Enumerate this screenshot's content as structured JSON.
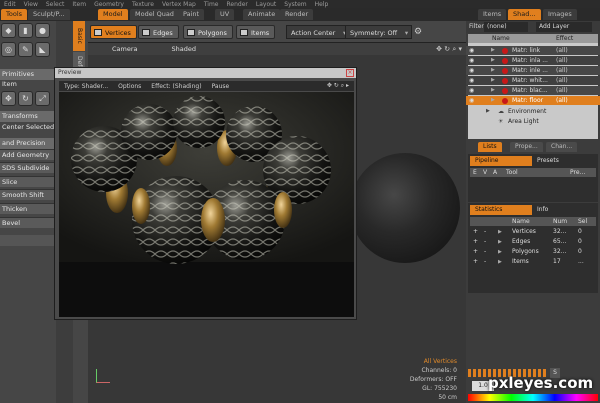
{
  "menubar": [
    "Edit",
    "View",
    "Select",
    "Item",
    "Geometry",
    "Texture",
    "Vertex Map",
    "Time",
    "Render",
    "Layout",
    "System",
    "Help"
  ],
  "layout_tabs": [
    "Tools",
    "Sculpt/P...",
    "Model",
    "Model Quad",
    "Paint",
    "UV",
    "Animate",
    "Render"
  ],
  "right_tabs": [
    "Items",
    "Shad...",
    "Images"
  ],
  "toolbar": {
    "vertices": "Vertices",
    "edges": "Edges",
    "polygons": "Polygons",
    "items": "Items",
    "action_center": "Action Center",
    "symmetry": "Symmetry: Off"
  },
  "left_panel": {
    "items": [
      "Primitives",
      "Item",
      "Transforms",
      "Center Selected",
      "and Precision",
      "Add Geometry",
      "SDS Subdivide",
      "Slice",
      "Smooth Shift",
      "Thicken",
      "Bevel"
    ],
    "vtab1": "Basic",
    "vtab2": "Deform"
  },
  "viewport": {
    "camera": "Camera",
    "shaded": "Shaded",
    "overlay_label": "All Vertices",
    "channels": "Channels: 0",
    "deformers": "Deformers: OFF",
    "gl": "GL: 755230",
    "scale": "50 cm",
    "icons": "✥ ↻ ⌕ ▾"
  },
  "preview": {
    "title": "Preview",
    "close": "×",
    "bar": [
      "Type: Shader...",
      "Options",
      "Effect: (Shading)",
      "Pause"
    ],
    "icons": "✥ ↻ ⌕ ▸"
  },
  "shader": {
    "filter_label": "Filter",
    "filter_value": "(none)",
    "add_layer": "Add Layer",
    "col_name": "Name",
    "col_effect": "Effect",
    "rows": [
      {
        "name": "Matr: link",
        "effect": "(all)"
      },
      {
        "name": "Matr: inla ...",
        "effect": "(all)"
      },
      {
        "name": "Matr: inle ...",
        "effect": "(all)"
      },
      {
        "name": "Matr: whit...",
        "effect": "(all)"
      },
      {
        "name": "Matr: blac...",
        "effect": "(all)"
      },
      {
        "name": "Matr: floor",
        "effect": "(all)"
      }
    ],
    "env": "Environment",
    "area_light": "Area Light"
  },
  "lower_tabs": [
    "Lists",
    "Prope...",
    "Chan..."
  ],
  "pipeline": {
    "tab": "Pipeline",
    "presets": "Presets",
    "cols": [
      "E",
      "V",
      "A",
      "Tool",
      "Pre..."
    ]
  },
  "statistics": {
    "tab": "Statistics",
    "info": "Info",
    "col_name": "Name",
    "col_num": "Num",
    "col_sel": "Sel",
    "rows": [
      {
        "name": "Vertices",
        "num": "32...",
        "sel": "0"
      },
      {
        "name": "Edges",
        "num": "65...",
        "sel": "0"
      },
      {
        "name": "Polygons",
        "num": "32...",
        "sel": "0"
      },
      {
        "name": "Items",
        "num": "17",
        "sel": "..."
      }
    ]
  },
  "timeline": {
    "value": "1.0",
    "s": "S"
  },
  "watermark": "pxleyes.com",
  "colors": {
    "accent": "#e07f1e",
    "material_ball": "#c81818",
    "panel": "#464646"
  }
}
